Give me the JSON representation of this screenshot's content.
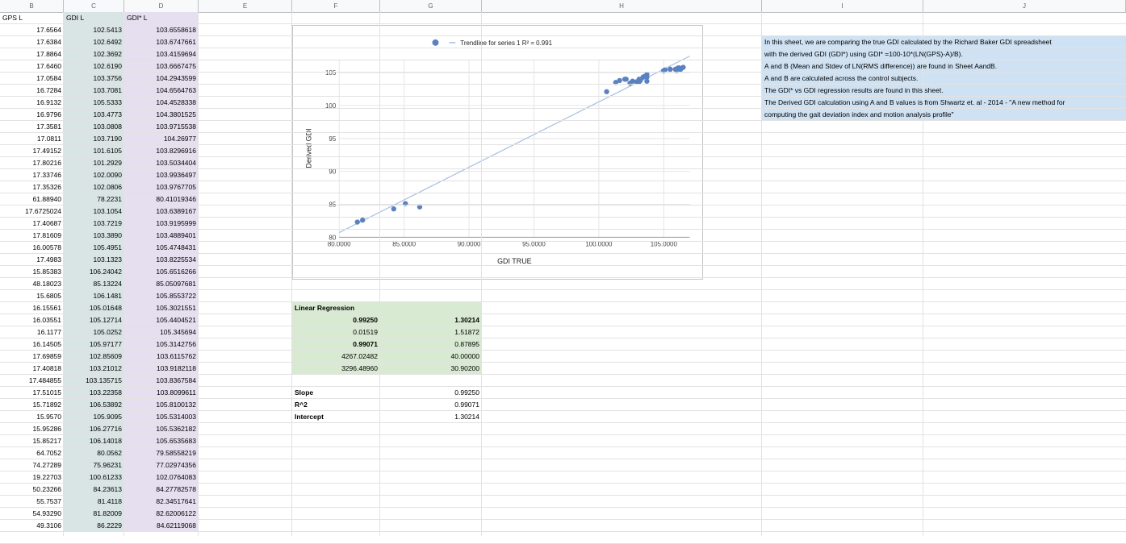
{
  "column_headers": [
    "B",
    "C",
    "D",
    "E",
    "F",
    "G",
    "H",
    "I",
    "J"
  ],
  "table": {
    "headers": [
      "GPS L",
      "GDI L",
      "GDI* L"
    ],
    "rows": [
      [
        "17.6564",
        "102.5413",
        "103.6558618"
      ],
      [
        "17.6384",
        "102.6492",
        "103.6747661"
      ],
      [
        "17.8864",
        "102.3692",
        "103.4159694"
      ],
      [
        "17.6460",
        "102.6190",
        "103.6667475"
      ],
      [
        "17.0584",
        "103.3756",
        "104.2943599"
      ],
      [
        "16.7284",
        "103.7081",
        "104.6564763"
      ],
      [
        "16.9132",
        "105.5333",
        "104.4528338"
      ],
      [
        "16.9796",
        "103.4773",
        "104.3801525"
      ],
      [
        "17.3581",
        "103.0808",
        "103.9715538"
      ],
      [
        "17.0811",
        "103.7190",
        "104.26977"
      ],
      [
        "17.49152",
        "101.6105",
        "103.8296916"
      ],
      [
        "17.80216",
        "101.2929",
        "103.5034404"
      ],
      [
        "17.33746",
        "102.0090",
        "103.9936497"
      ],
      [
        "17.35326",
        "102.0806",
        "103.9767705"
      ],
      [
        "61.88940",
        "78.2231",
        "80.41019346"
      ],
      [
        "17.6725024",
        "103.1054",
        "103.6389167"
      ],
      [
        "17.40687",
        "103.7219",
        "103.9195999"
      ],
      [
        "17.81609",
        "103.3890",
        "103.4889401"
      ],
      [
        "16.00578",
        "105.4951",
        "105.4748431"
      ],
      [
        "17.4983",
        "103.1323",
        "103.8225534"
      ],
      [
        "15.85383",
        "106.24042",
        "105.6516266"
      ],
      [
        "48.18023",
        "85.13224",
        "85.05097681"
      ],
      [
        "15.6805",
        "106.1481",
        "105.8553722"
      ],
      [
        "16.15561",
        "105.01648",
        "105.3021551"
      ],
      [
        "16.03551",
        "105.12714",
        "105.4404521"
      ],
      [
        "16.1177",
        "105.0252",
        "105.345694"
      ],
      [
        "16.14505",
        "105.97177",
        "105.3142756"
      ],
      [
        "17.69859",
        "102.85609",
        "103.6115762"
      ],
      [
        "17.40818",
        "103.21012",
        "103.9182118"
      ],
      [
        "17.484855",
        "103.135715",
        "103.8367584"
      ],
      [
        "17.51015",
        "103.22358",
        "103.8099611"
      ],
      [
        "15.71892",
        "106.53892",
        "105.8100132"
      ],
      [
        "15.9570",
        "105.9095",
        "105.5314003"
      ],
      [
        "15.95286",
        "106.27716",
        "105.5362182"
      ],
      [
        "15.85217",
        "106.14018",
        "105.6535683"
      ],
      [
        "64.7052",
        "80.0562",
        "79.58558219"
      ],
      [
        "74.27289",
        "75.96231",
        "77.02974356"
      ],
      [
        "19.22703",
        "100.61233",
        "102.0764083"
      ],
      [
        "50.23266",
        "84.23613",
        "84.27782578"
      ],
      [
        "55.7537",
        "81.4118",
        "82.34517641"
      ],
      [
        "54.93290",
        "81.82009",
        "82.62006122"
      ],
      [
        "49.3106",
        "86.2229",
        "84.62119068"
      ]
    ]
  },
  "regression": {
    "header": "Linear Regression",
    "rows": [
      [
        "0.99250",
        "1.30214"
      ],
      [
        "0.01519",
        "1.51872"
      ],
      [
        "0.99071",
        "0.87895"
      ],
      [
        "4267.02482",
        "40.00000"
      ],
      [
        "3296.48960",
        "30.90200"
      ]
    ]
  },
  "summary": [
    {
      "label": "Slope",
      "value": "0.99250"
    },
    {
      "label": "R^2",
      "value": "0.99071"
    },
    {
      "label": "Intercept",
      "value": "1.30214"
    }
  ],
  "notes": [
    "In this sheet, we are comparing the true GDI calculated by the Richard Baker GDI spreadsheet",
    "with  the derived GDI (GDI*) using GDI* =100-10*(LN(GPS)-A)/B).",
    "A and B (Mean and Stdev of LN(RMS difference)) are found in Sheet AandB.",
    "A and B are calculated across the control subjects.",
    "The GDI* vs GDI regression results are found in this sheet.",
    "The Derived GDI calculation using A and B values is from Shwartz et. al - 2014 - \"A new method for",
    "computing the gait deviation index and motion analysis profile\""
  ],
  "colors": {
    "gdi_fill": "#d9e4e4",
    "gdistar_fill": "#e5dff0",
    "regression_fill": "#d9ead3",
    "notes_fill": "#cfe2f3",
    "point": "#5b82c0",
    "trend": "#a8bfe3"
  },
  "chart_data": {
    "type": "scatter",
    "title": "",
    "xlabel": "GDI TRUE",
    "ylabel": "Derived GDI",
    "xlim": [
      80,
      107
    ],
    "ylim": [
      80,
      107
    ],
    "x_ticks": [
      "80.0000",
      "85.0000",
      "90.0000",
      "95.0000",
      "100.0000",
      "105.0000"
    ],
    "y_ticks": [
      "80",
      "85",
      "90",
      "95",
      "100",
      "105"
    ],
    "legend": "Trendline for series 1 R² = 0.991",
    "legend_position": "top",
    "grid": true,
    "trendline": {
      "slope": 0.9925,
      "intercept": 1.30214
    },
    "points": [
      [
        81.4,
        82.3
      ],
      [
        81.8,
        82.6
      ],
      [
        84.2,
        84.3
      ],
      [
        85.1,
        85.1
      ],
      [
        86.2,
        84.6
      ],
      [
        100.6,
        102.1
      ],
      [
        101.3,
        103.5
      ],
      [
        101.6,
        103.8
      ],
      [
        102.0,
        104.0
      ],
      [
        102.1,
        104.0
      ],
      [
        102.4,
        103.4
      ],
      [
        102.6,
        103.7
      ],
      [
        102.9,
        103.6
      ],
      [
        103.1,
        103.6
      ],
      [
        103.1,
        104.0
      ],
      [
        103.2,
        103.8
      ],
      [
        103.2,
        103.9
      ],
      [
        103.4,
        104.3
      ],
      [
        103.5,
        104.4
      ],
      [
        103.7,
        103.7
      ],
      [
        103.7,
        104.3
      ],
      [
        103.7,
        104.7
      ],
      [
        105.0,
        105.3
      ],
      [
        105.0,
        105.3
      ],
      [
        105.1,
        105.4
      ],
      [
        105.5,
        105.5
      ],
      [
        105.5,
        105.5
      ],
      [
        105.9,
        105.5
      ],
      [
        106.0,
        105.3
      ],
      [
        106.1,
        105.7
      ],
      [
        106.2,
        105.7
      ],
      [
        106.3,
        105.5
      ],
      [
        106.5,
        105.8
      ]
    ]
  }
}
